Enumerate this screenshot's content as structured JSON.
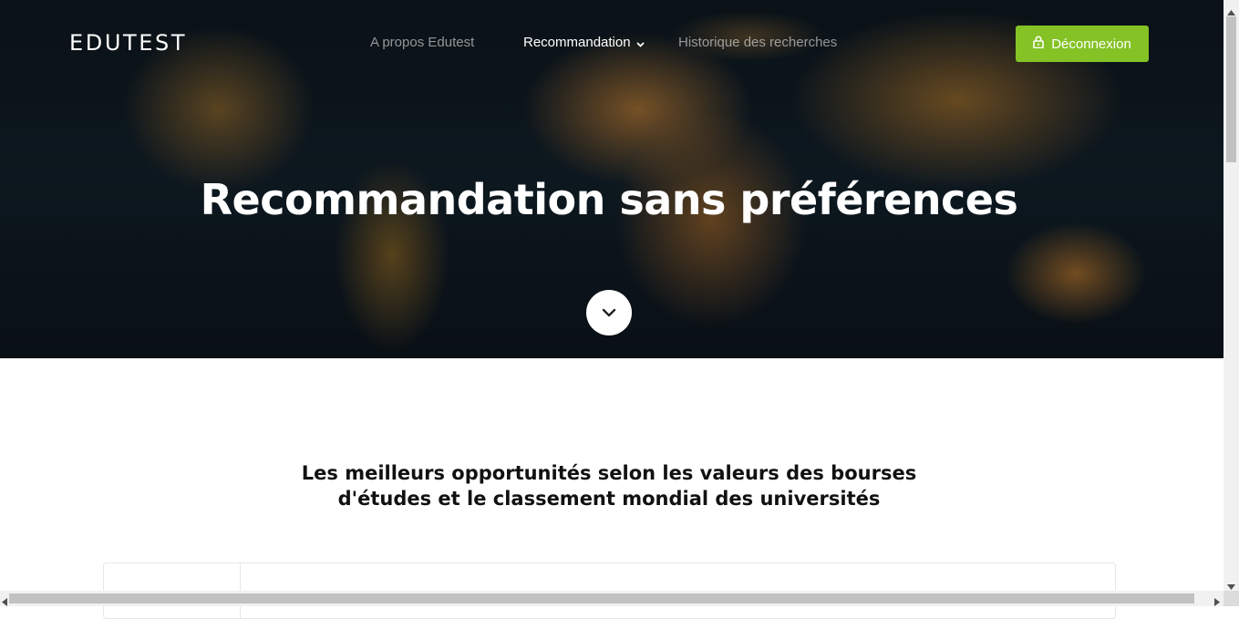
{
  "header": {
    "brand": "EDUTEST",
    "nav": [
      {
        "label": "A propos Edutest",
        "active": false
      },
      {
        "label": "Recommandation",
        "active": true,
        "has_dropdown": true
      },
      {
        "label": "Historique des recherches",
        "active": false
      }
    ],
    "logout_label": "Déconnexion",
    "logout_icon": "lock-icon",
    "accent_color": "#84c225"
  },
  "hero": {
    "title": "Recommandation sans préférences",
    "scroll_icon": "chevron-down-icon"
  },
  "main": {
    "heading_line1": "Les meilleurs opportunités selon les valeurs des bourses",
    "heading_line2": "d'études et le classement mondial des universités"
  }
}
